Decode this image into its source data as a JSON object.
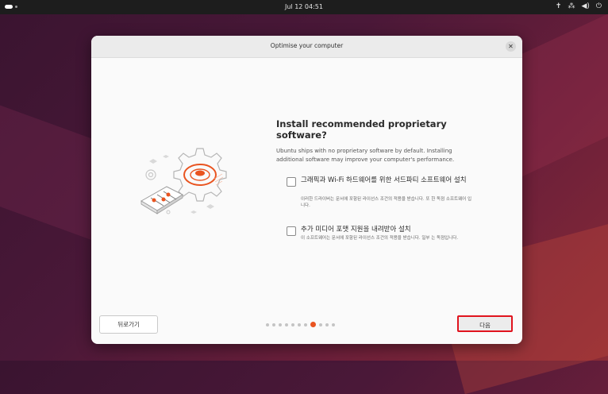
{
  "topbar": {
    "clock": "Jul 12  04:51",
    "icons": [
      "accessibility-icon",
      "network-icon",
      "volume-icon",
      "power-icon"
    ],
    "glyphs": [
      "✝",
      "⁂",
      "◀)",
      "⏻"
    ]
  },
  "dialog": {
    "title": "Optimise your computer",
    "close_glyph": "✕",
    "heading": "Install recommended proprietary software?",
    "description": "Ubuntu ships with no proprietary software by default. Installing additional software may improve your computer's performance.",
    "options": [
      {
        "label": "그래픽과 Wi-Fi 하드웨어를 위한 서드파티 소프트웨어 설치",
        "sub": "이러한 드라이버는 문서에 포함된 라이선스 조건의 적용을 받습니다. 또 한 독점 소프트웨어 입니다.",
        "checked": false
      },
      {
        "label": "추가 미디어 포맷 지원을 내려받아 설치",
        "sub": "이 소프트웨어는 문서에 포함된 라이선스 조건의 적용을 받습니다. 일부 는 독점입니다.",
        "checked": false
      }
    ],
    "back_label": "뒤로가기",
    "next_label": "다음",
    "pager": {
      "total": 11,
      "current_index": 7
    }
  },
  "colors": {
    "accent": "#e95420",
    "highlight_border": "#e0141e"
  }
}
